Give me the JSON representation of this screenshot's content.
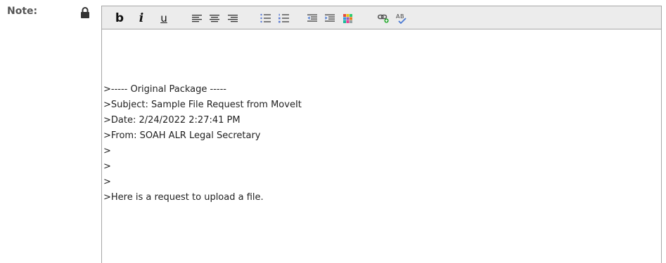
{
  "note": {
    "label": "Note:"
  },
  "toolbar": {
    "bold_label": "b",
    "italic_label": "i",
    "underline_label": "u"
  },
  "body_lines": [
    ">----- Original Package -----",
    ">Subject: Sample File Request from MoveIt",
    ">Date: 2/24/2022 2:27:41 PM",
    ">From: SOAH ALR Legal Secretary",
    ">",
    ">",
    ">",
    ">Here is a request to upload a file."
  ],
  "icons": {
    "lock": "lock-icon",
    "align_left": "align-left-icon",
    "align_center": "align-center-icon",
    "align_right": "align-right-icon",
    "bullet_list": "bullet-list-icon",
    "numbered_list": "numbered-list-icon",
    "outdent": "outdent-icon",
    "indent": "indent-icon",
    "color": "color-palette-icon",
    "link": "link-icon",
    "spellcheck": "spellcheck-icon"
  },
  "colors": {
    "toolbar_bg": "#ececec",
    "border": "#a6a6a6",
    "label": "#555555",
    "text": "#222222"
  }
}
